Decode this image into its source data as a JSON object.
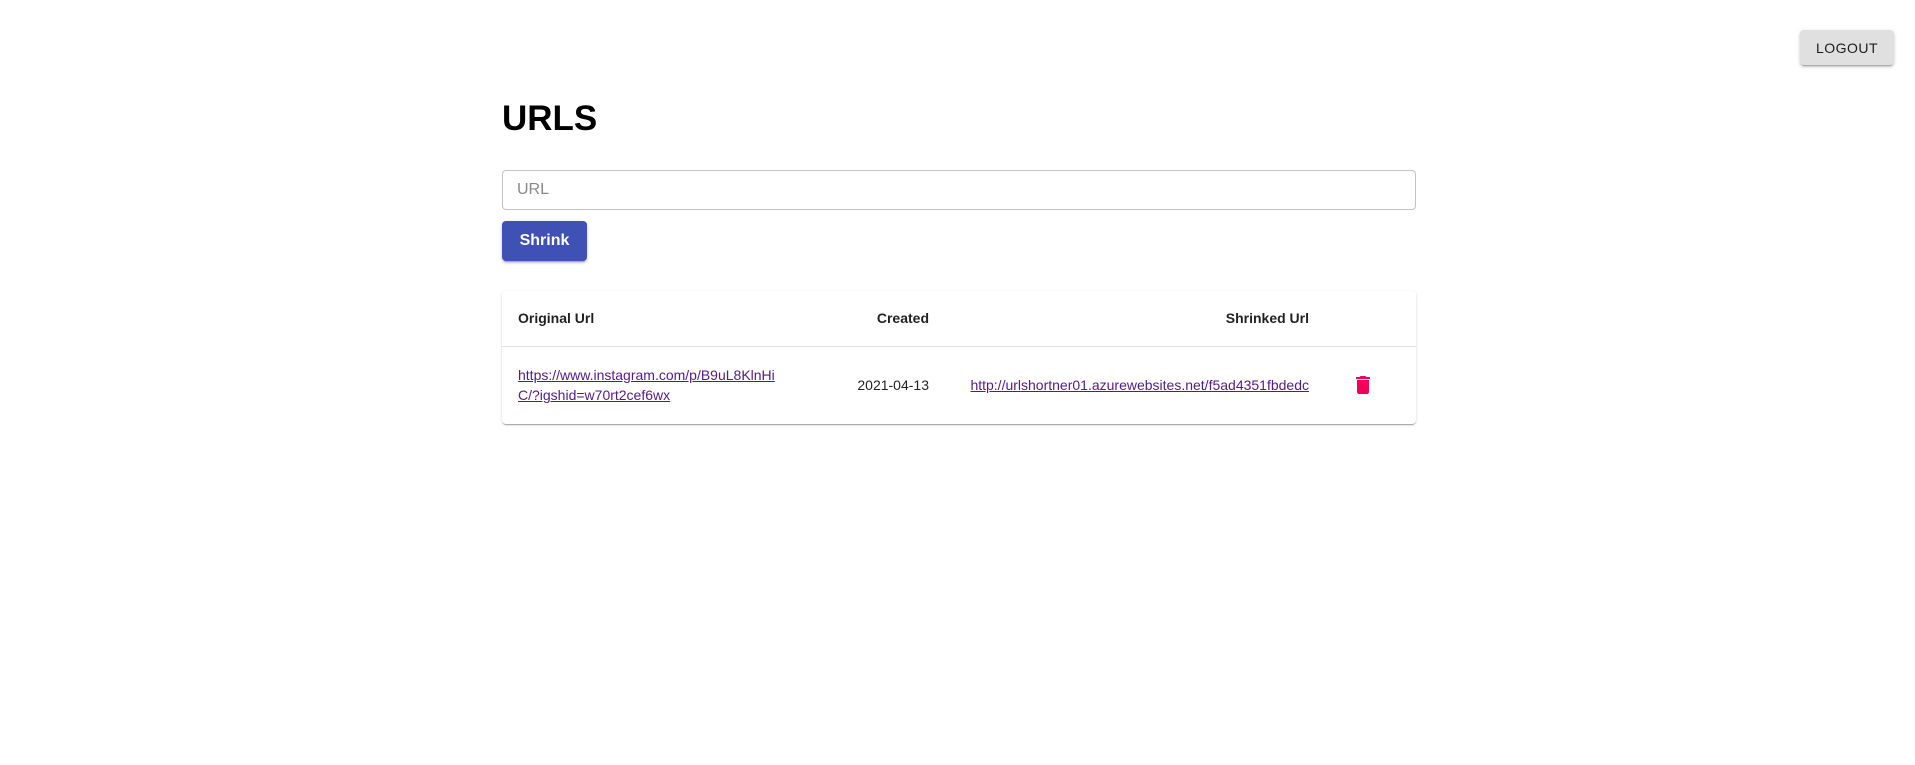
{
  "header": {
    "logout_label": "LOGOUT"
  },
  "main": {
    "title": "URLS",
    "url_input": {
      "placeholder": "URL",
      "value": ""
    },
    "shrink_label": "Shrink"
  },
  "table": {
    "headers": {
      "original": "Original Url",
      "created": "Created",
      "shrinked": "Shrinked Url"
    },
    "rows": [
      {
        "original_url": "https://www.instagram.com/p/B9uL8KlnHiC/?igshid=w70rt2cef6wx",
        "created": "2021-04-13",
        "shrinked_url": "http://urlshortner01.azurewebsites.net/f5ad4351fbdedc",
        "delete_icon": "trash-icon"
      }
    ]
  },
  "colors": {
    "primary": "#3f51b5",
    "delete": "#f50057",
    "link": "#551a8b",
    "logout_bg": "#e0e0e0"
  }
}
